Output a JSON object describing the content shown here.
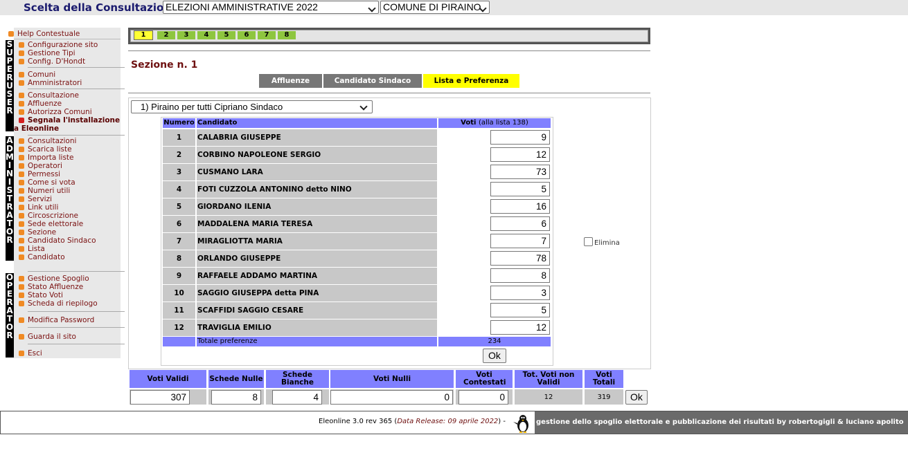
{
  "top": {
    "title": "Scelta della Consultazione:",
    "consultazione": "ELEZIONI AMMINISTRATIVE 2022",
    "comune": "COMUNE DI PIRAINO"
  },
  "sidebar": {
    "strip_superuser": "SUPERUSER",
    "strip_admin": "ADMINISTRATOR",
    "strip_operator": "OPERATOR",
    "items": {
      "help": "Help Contestuale",
      "config_sito": "Configurazione sito",
      "gestione_tipi": "Gestione Tipi",
      "config_dhondt": "Config. D'Hondt",
      "comuni": "Comuni",
      "amministratori": "Amministratori",
      "consultazione": "Consultazione",
      "affluenze": "Affluenze",
      "autorizza": "Autorizza Comuni",
      "segnala1": "Segnala l'installazione",
      "segnala2": "a Eleonline",
      "consultazioni": "Consultazioni",
      "scarica": "Scarica liste",
      "importa": "Importa liste",
      "operatori": "Operatori",
      "permessi": "Permessi",
      "come_si_vota": "Come si vota",
      "numeri_utili": "Numeri utili",
      "servizi": "Servizi",
      "link_utili": "Link utili",
      "circoscrizione": "Circoscrizione",
      "sede": "Sede elettorale",
      "sezione": "Sezione",
      "candidato_sindaco": "Candidato Sindaco",
      "lista": "Lista",
      "candidato": "Candidato",
      "gestione_spoglio": "Gestione Spoglio",
      "stato_affluenze": "Stato Affluenze",
      "stato_voti": "Stato Voti",
      "scheda_riepilogo": "Scheda di riepilogo",
      "modifica_password": "Modifica Password",
      "guarda_sito": "Guarda il sito",
      "esci": "Esci"
    }
  },
  "section_tabs": [
    "1",
    "2",
    "3",
    "4",
    "5",
    "6",
    "7",
    "8"
  ],
  "active_section_tab": "1",
  "page_title": "Sezione n. 1",
  "mode_tabs": {
    "affluenze": "Affluenze",
    "candidato_sindaco": "Candidato Sindaco",
    "lista_preferenza": "Lista e Preferenza"
  },
  "list_select": "1) Piraino per tutti Cipriano Sindaco",
  "table": {
    "col_numero": "Numero",
    "col_candidato": "Candidato",
    "col_voti": "Voti",
    "col_voti_note": "(alla lista 138)",
    "rows": [
      {
        "n": "1",
        "name": "CALABRIA GIUSEPPE",
        "voti": "9"
      },
      {
        "n": "2",
        "name": "CORBINO NAPOLEONE SERGIO",
        "voti": "12"
      },
      {
        "n": "3",
        "name": "CUSMANO LARA",
        "voti": "73"
      },
      {
        "n": "4",
        "name": "FOTI CUZZOLA ANTONINO detto NINO",
        "voti": "5"
      },
      {
        "n": "5",
        "name": "GIORDANO ILENIA",
        "voti": "16"
      },
      {
        "n": "6",
        "name": "MADDALENA MARIA TERESA",
        "voti": "6"
      },
      {
        "n": "7",
        "name": "MIRAGLIOTTA MARIA",
        "voti": "7"
      },
      {
        "n": "8",
        "name": "ORLANDO GIUSEPPE",
        "voti": "78"
      },
      {
        "n": "9",
        "name": "RAFFAELE ADDAMO MARTINA",
        "voti": "8"
      },
      {
        "n": "10",
        "name": "SAGGIO GIUSEPPA detta PINA",
        "voti": "3"
      },
      {
        "n": "11",
        "name": "SCAFFIDI SAGGIO CESARE",
        "voti": "5"
      },
      {
        "n": "12",
        "name": "TRAVIGLIA EMILIO",
        "voti": "12"
      }
    ],
    "totale_label": "Totale preferenze",
    "totale_value": "234",
    "ok": "Ok"
  },
  "elimina": "Elimina",
  "bottom": {
    "voti_validi_label": "Voti Validi",
    "schede_nulle_label": "Schede Nulle",
    "schede_bianche_label": "Schede Bianche",
    "voti_nulli_label": "Voti Nulli",
    "voti_contestati_label": "Voti Contestati",
    "tot_non_validi_label": "Tot. Voti non Validi",
    "voti_totali_label": "Voti Totali",
    "voti_validi": "307",
    "schede_nulle": "8",
    "schede_bianche": "4",
    "voti_nulli": "0",
    "voti_contestati": "0",
    "tot_non_validi": "12",
    "voti_totali": "319",
    "ok": "Ok"
  },
  "footer": {
    "version": "Eleonline 3.0 rev 365",
    "release": "Data Release: 09 aprile 2022",
    "credits": "gestione dello spoglio elettorale e pubblicazione dei risultati by robertogigli & luciano apolito"
  }
}
